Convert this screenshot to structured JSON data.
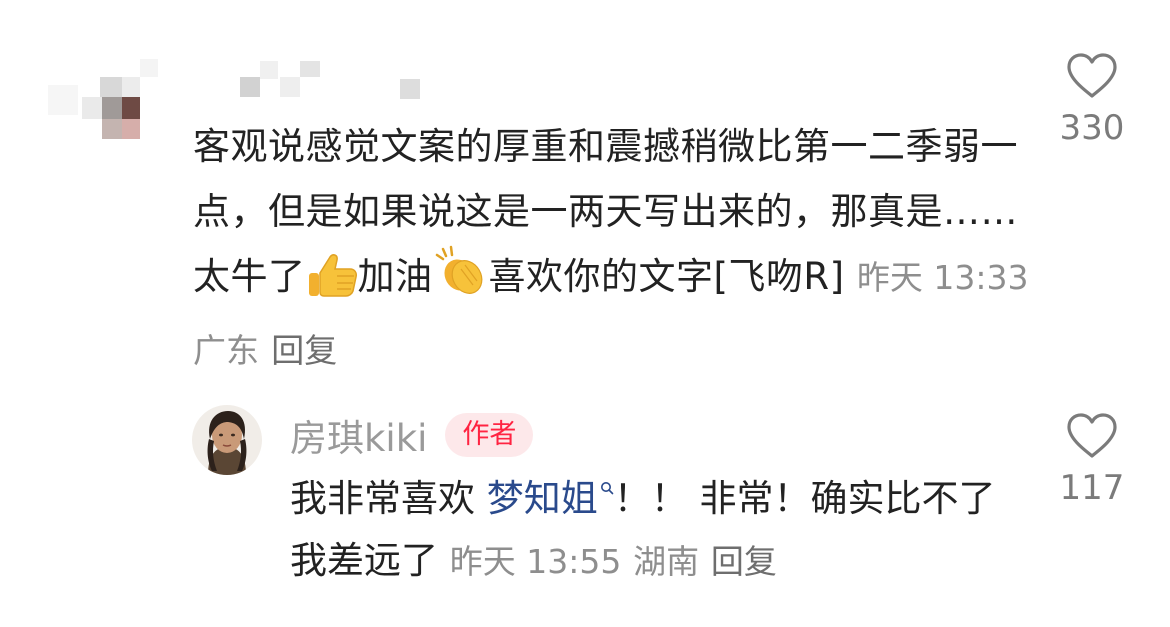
{
  "comment": {
    "text_main": "客观说感觉文案的厚重和震撼稍微比第一二季弱一点，但是如果说这是一两天写出来的，那真是……太牛了",
    "text_after_thumb": "加油",
    "text_after_clap": "喜欢你的文字[飞吻R]",
    "time": "昨天 13:33",
    "location": "广东",
    "reply_label": "回复",
    "likes": "330",
    "emojis": [
      "thumbs-up-icon",
      "clapping-hands-icon"
    ]
  },
  "reply": {
    "author": "房琪kiki",
    "badge": "作者",
    "text_before_mention": "我非常喜欢 ",
    "mention": "梦知姐",
    "text_after_mention": "！！ 非常！确实比不了 我差远了",
    "time": "昨天 13:55",
    "location": "湖南",
    "reply_label": "回复",
    "likes": "117"
  },
  "colors": {
    "text": "#222222",
    "meta": "#8e8e8e",
    "author_name": "#9a9a9a",
    "badge_text": "#ff2442",
    "badge_bg": "#fde8ea",
    "mention": "#2a4a8c"
  }
}
